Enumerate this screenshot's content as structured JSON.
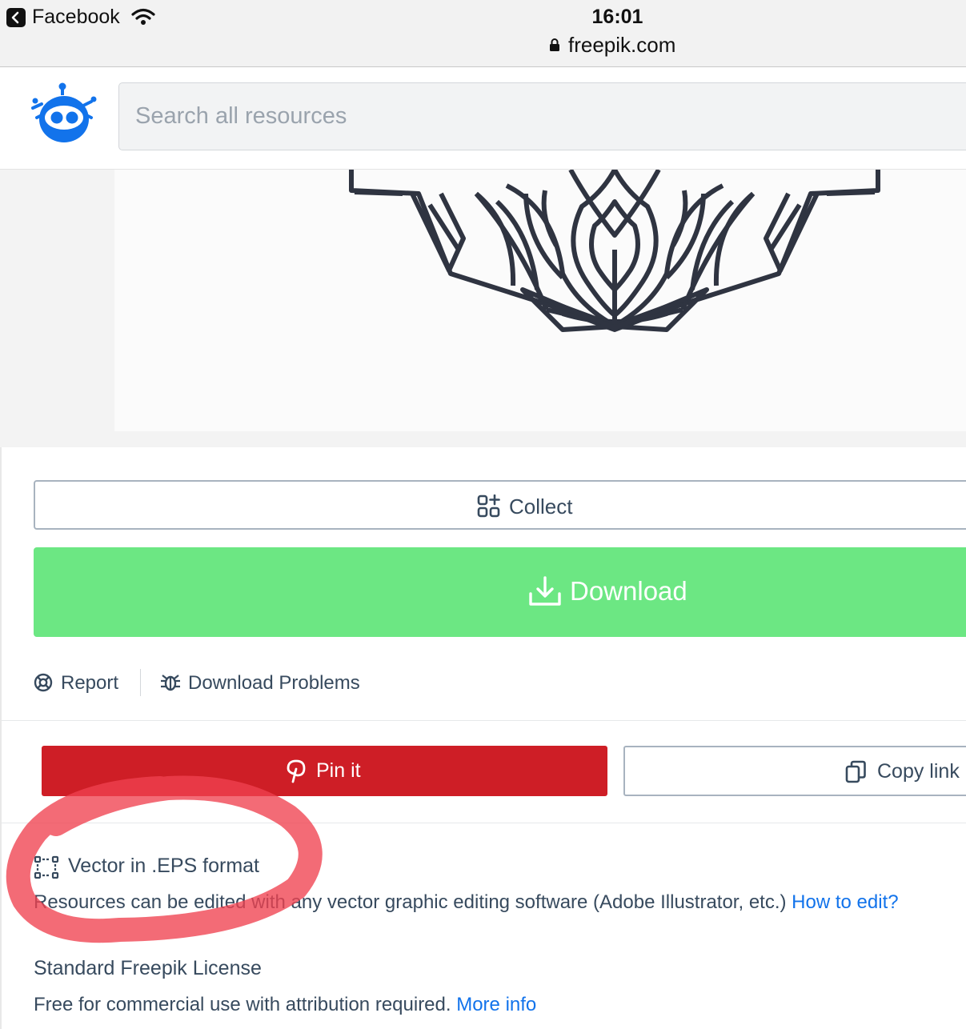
{
  "status_bar": {
    "back_app": "Facebook",
    "time": "16:01",
    "url": "freepik.com"
  },
  "header": {
    "search_placeholder": "Search all resources"
  },
  "actions": {
    "collect_label": "Collect",
    "download_label": "Download",
    "report_label": "Report",
    "download_problems_label": "Download Problems"
  },
  "share": {
    "pin_label": "Pin it",
    "copy_label": "Copy link"
  },
  "format_info": {
    "title": "Vector in .EPS format",
    "description": "Resources can be edited with any vector graphic editing software (Adobe Illustrator, etc.)",
    "link": "How to edit?"
  },
  "license": {
    "title": "Standard Freepik License",
    "description": "Free for commercial use with attribution required.",
    "link": "More info"
  },
  "colors": {
    "brand_blue": "#1273eb",
    "download_green": "#6ce783",
    "pinterest_red": "#ce1e26",
    "annotation_red": "#f0414f"
  }
}
